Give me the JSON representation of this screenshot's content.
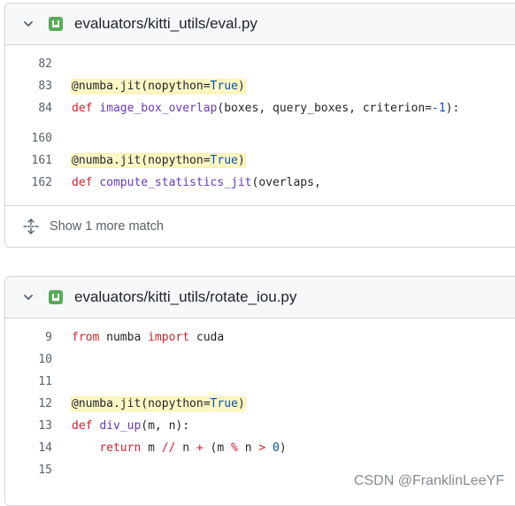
{
  "results": [
    {
      "file_path": "evaluators/kitti_utils/eval.py",
      "blocks": [
        {
          "lines": [
            {
              "n": "82",
              "tokens": []
            },
            {
              "n": "83",
              "tokens": [
                {
                  "t": "@numba.jit(nopython=",
                  "c": "hl"
                },
                {
                  "t": "True",
                  "c": "hl pl"
                },
                {
                  "t": ")",
                  "c": "hl"
                }
              ]
            },
            {
              "n": "84",
              "tokens": [
                {
                  "t": "def",
                  "c": "kw"
                },
                {
                  "t": " ",
                  "c": ""
                },
                {
                  "t": "image_box_overlap",
                  "c": "fn"
                },
                {
                  "t": "(boxes, query_boxes, criterion=",
                  "c": ""
                },
                {
                  "t": "-1",
                  "c": "pl"
                },
                {
                  "t": "):",
                  "c": ""
                }
              ]
            }
          ]
        },
        {
          "lines": [
            {
              "n": "160",
              "tokens": []
            },
            {
              "n": "161",
              "tokens": [
                {
                  "t": "@numba.jit(nopython=",
                  "c": "hl"
                },
                {
                  "t": "True",
                  "c": "hl pl"
                },
                {
                  "t": ")",
                  "c": "hl"
                }
              ]
            },
            {
              "n": "162",
              "tokens": [
                {
                  "t": "def",
                  "c": "kw"
                },
                {
                  "t": " ",
                  "c": ""
                },
                {
                  "t": "compute_statistics_jit",
                  "c": "fn"
                },
                {
                  "t": "(overlaps,",
                  "c": ""
                }
              ]
            }
          ]
        }
      ],
      "footer": "Show 1 more match"
    },
    {
      "file_path": "evaluators/kitti_utils/rotate_iou.py",
      "blocks": [
        {
          "lines": [
            {
              "n": "9",
              "tokens": [
                {
                  "t": "from",
                  "c": "kw"
                },
                {
                  "t": " numba ",
                  "c": ""
                },
                {
                  "t": "import",
                  "c": "kw"
                },
                {
                  "t": " cuda",
                  "c": ""
                }
              ]
            },
            {
              "n": "10",
              "tokens": []
            },
            {
              "n": "11",
              "tokens": []
            },
            {
              "n": "12",
              "tokens": [
                {
                  "t": "@numba.jit(nopython=",
                  "c": "hl"
                },
                {
                  "t": "True",
                  "c": "hl pl"
                },
                {
                  "t": ")",
                  "c": "hl"
                }
              ]
            },
            {
              "n": "13",
              "tokens": [
                {
                  "t": "def",
                  "c": "kw"
                },
                {
                  "t": " ",
                  "c": ""
                },
                {
                  "t": "div_up",
                  "c": "fn"
                },
                {
                  "t": "(m, n):",
                  "c": ""
                }
              ]
            },
            {
              "n": "14",
              "tokens": [
                {
                  "t": "    ",
                  "c": ""
                },
                {
                  "t": "return",
                  "c": "kw"
                },
                {
                  "t": " m ",
                  "c": ""
                },
                {
                  "t": "//",
                  "c": "kw"
                },
                {
                  "t": " n ",
                  "c": ""
                },
                {
                  "t": "+",
                  "c": "kw"
                },
                {
                  "t": " (m ",
                  "c": ""
                },
                {
                  "t": "%",
                  "c": "kw"
                },
                {
                  "t": " n ",
                  "c": ""
                },
                {
                  "t": ">",
                  "c": "kw"
                },
                {
                  "t": " ",
                  "c": ""
                },
                {
                  "t": "0",
                  "c": "pl"
                },
                {
                  "t": ")",
                  "c": ""
                }
              ]
            },
            {
              "n": "15",
              "tokens": []
            }
          ]
        }
      ]
    }
  ],
  "watermark": "CSDN @FranklinLeeYF",
  "colors": {
    "keyword": "#cf222e",
    "function": "#6639ba",
    "constant": "#0550ae",
    "highlight": "#fff8c5",
    "file_icon": "#57ab5a"
  }
}
